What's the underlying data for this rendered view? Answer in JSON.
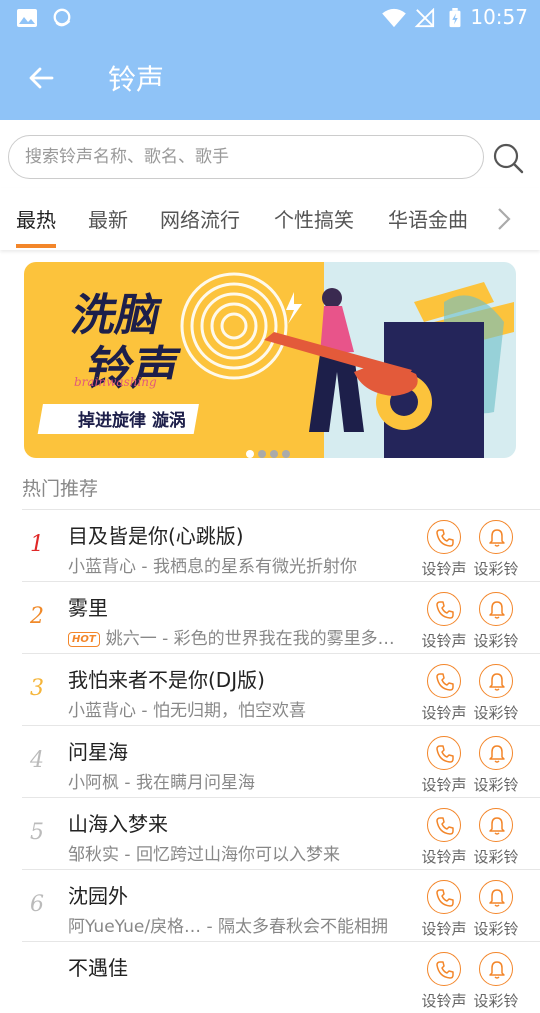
{
  "status_bar": {
    "time": "10:57"
  },
  "app_bar": {
    "title": "铃声"
  },
  "search": {
    "placeholder": "搜索铃声名称、歌名、歌手"
  },
  "tabs": [
    {
      "label": "最热",
      "active": true
    },
    {
      "label": "最新"
    },
    {
      "label": "网络流行"
    },
    {
      "label": "个性搞笑"
    },
    {
      "label": "华语金曲"
    }
  ],
  "banner": {
    "headline_line1": "洗脑",
    "headline_line2": "铃声",
    "tagline": "掉进旋律 漩涡",
    "script": "brainwashing",
    "page_count": 4,
    "active_page": 0
  },
  "section": {
    "title": "热门推荐"
  },
  "list": {
    "ring_label": "设铃声",
    "crbt_label": "设彩铃",
    "hot_badge": "HOT",
    "items": [
      {
        "rank": "1",
        "title": "目及皆是你(心跳版)",
        "artist": "小蓝背心",
        "desc": "我栖息的星系有微光折射你",
        "hot": false
      },
      {
        "rank": "2",
        "title": "雾里",
        "artist": "姚六一",
        "desc": "彩色的世界我在我的雾里多…",
        "hot": true
      },
      {
        "rank": "3",
        "title": "我怕来者不是你(DJ版)",
        "artist": "小蓝背心",
        "desc": "怕无归期，怕空欢喜",
        "hot": false
      },
      {
        "rank": "4",
        "title": "问星海",
        "artist": "小阿枫",
        "desc": "我在瞒月问星海",
        "hot": false
      },
      {
        "rank": "5",
        "title": "山海入梦来",
        "artist": "邹秋实",
        "desc": "回忆跨过山海你可以入梦来",
        "hot": false
      },
      {
        "rank": "6",
        "title": "沈园外",
        "artist": "阿YueYue/戾格…",
        "desc": "隔太多春秋会不能相拥",
        "hot": false
      },
      {
        "rank": "",
        "title": "不遇佳",
        "artist": "",
        "desc": "",
        "hot": false
      }
    ]
  },
  "colors": {
    "header": "#8fc3f7",
    "accent": "#f3862a",
    "rank1": "#e02828",
    "rank2": "#f08a2a",
    "rank3": "#f5b53a",
    "rank_other": "#bbbbbb"
  }
}
